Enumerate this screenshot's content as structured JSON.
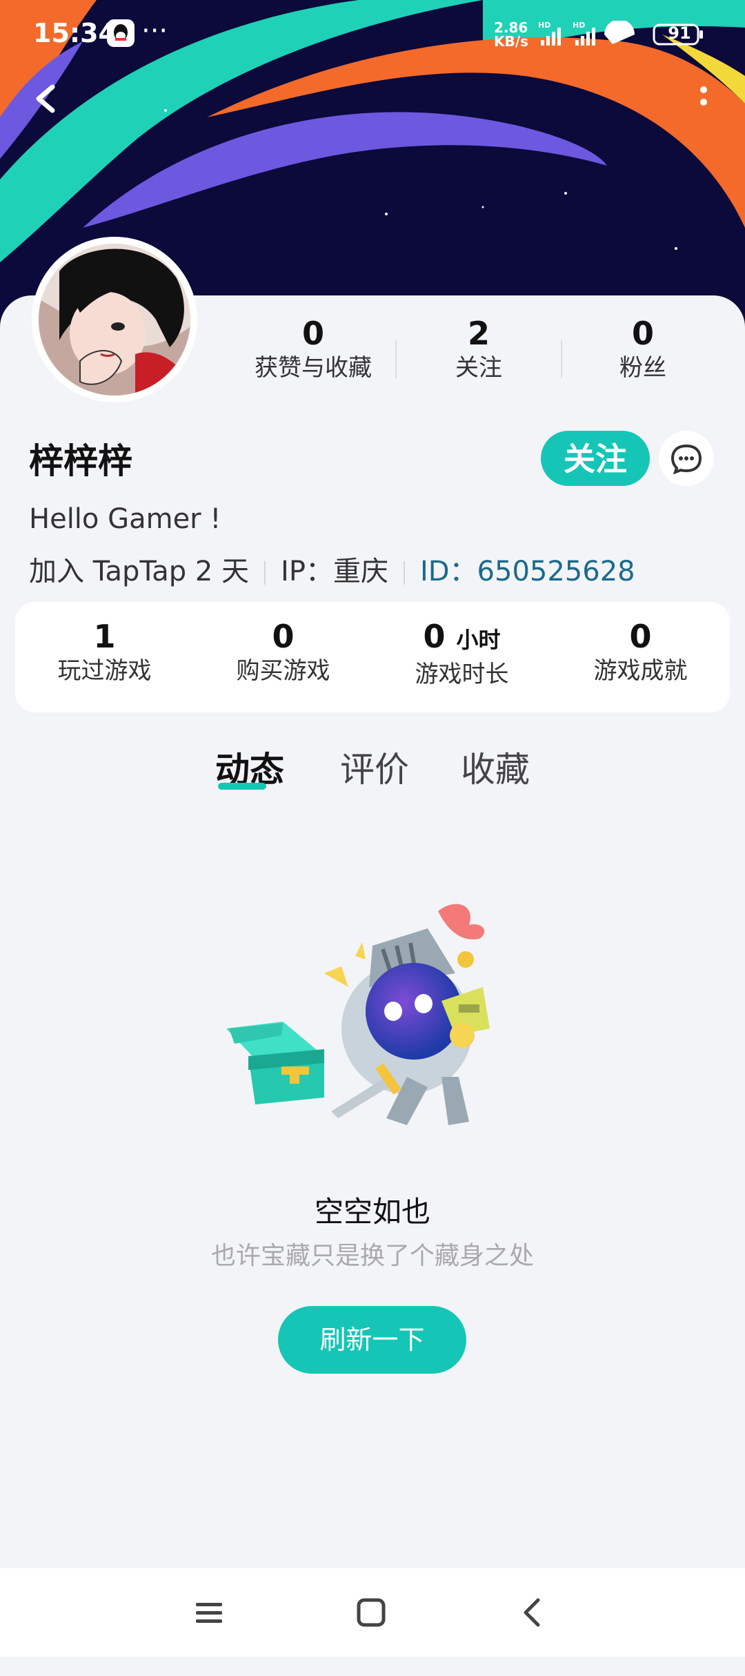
{
  "status_bar": {
    "time": "15:34",
    "more": "···",
    "speed_value": "2.86",
    "speed_unit": "KB/s",
    "battery": "91"
  },
  "profile": {
    "stats": [
      {
        "value": "0",
        "label": "获赞与收藏"
      },
      {
        "value": "2",
        "label": "关注"
      },
      {
        "value": "0",
        "label": "粉丝"
      }
    ],
    "username": "梓梓梓",
    "follow_label": "关注",
    "bio": "Hello Gamer !",
    "joined": "加入 TapTap 2 天",
    "ip": "IP：重庆",
    "id": "ID：650525628"
  },
  "game_stats": [
    {
      "value": "1",
      "unit": "",
      "label": "玩过游戏"
    },
    {
      "value": "0",
      "unit": "",
      "label": "购买游戏"
    },
    {
      "value": "0",
      "unit": "小时",
      "label": "游戏时长"
    },
    {
      "value": "0",
      "unit": "",
      "label": "游戏成就"
    }
  ],
  "tabs": [
    {
      "label": "动态",
      "active": true
    },
    {
      "label": "评价",
      "active": false
    },
    {
      "label": "收藏",
      "active": false
    }
  ],
  "empty_state": {
    "title": "空空如也",
    "subtitle": "也许宝藏只是换了个藏身之处",
    "button": "刷新一下"
  },
  "colors": {
    "accent": "#15c6b7",
    "id_link": "#1a6a8c"
  }
}
